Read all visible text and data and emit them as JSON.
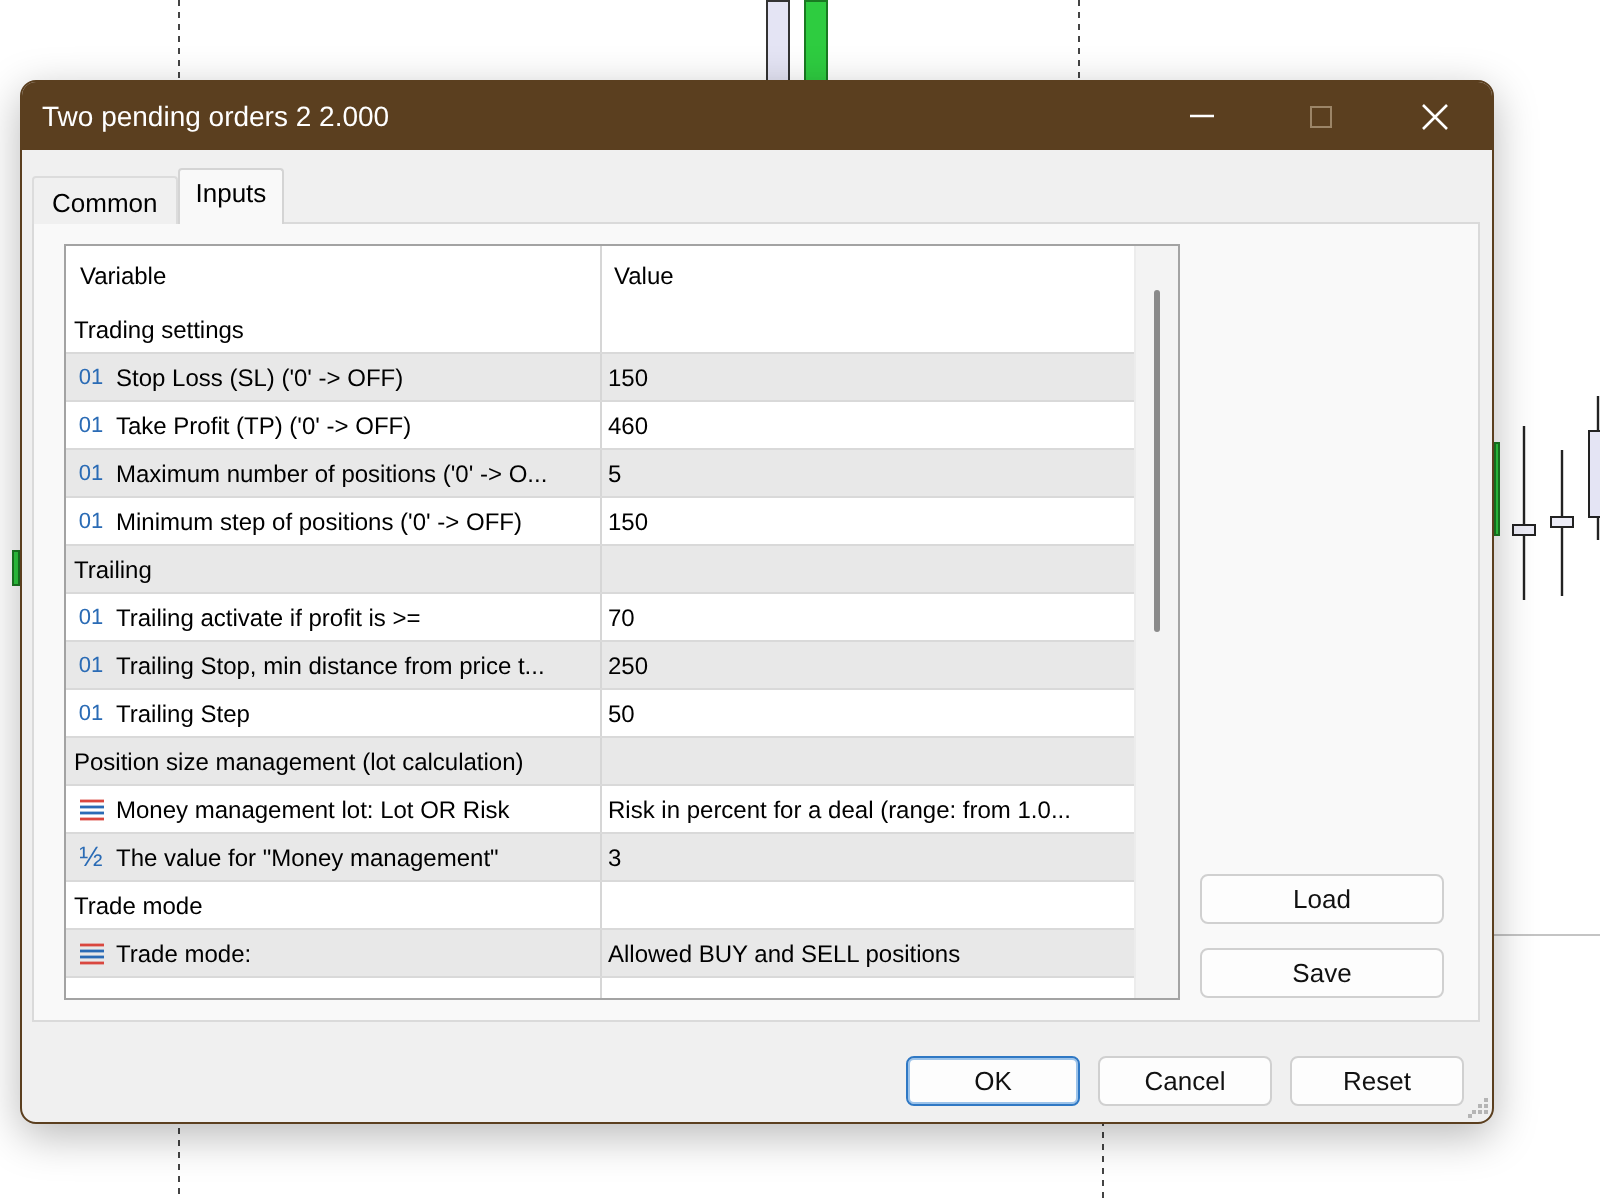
{
  "window": {
    "title": "Two pending orders 2 2.000",
    "maximize_disabled": true
  },
  "tabs": [
    {
      "label": "Common",
      "selected": false
    },
    {
      "label": "Inputs",
      "selected": true
    }
  ],
  "inputs_table": {
    "columns": [
      "Variable",
      "Value"
    ],
    "rows": [
      {
        "kind": "group",
        "variable": "Trading settings"
      },
      {
        "kind": "int",
        "icon": "01",
        "variable": "Stop Loss (SL) ('0' -> OFF)",
        "value": "150"
      },
      {
        "kind": "int",
        "icon": "01",
        "variable": "Take Profit (TP) ('0' -> OFF)",
        "value": "460"
      },
      {
        "kind": "int",
        "icon": "01",
        "variable": "Maximum number of positions ('0' -> O...",
        "value": "5"
      },
      {
        "kind": "int",
        "icon": "01",
        "variable": "Minimum step of positions ('0' -> OFF)",
        "value": "150"
      },
      {
        "kind": "group",
        "variable": "Trailing"
      },
      {
        "kind": "int",
        "icon": "01",
        "variable": "Trailing activate if profit is >=",
        "value": "70"
      },
      {
        "kind": "int",
        "icon": "01",
        "variable": "Trailing Stop, min distance from price t...",
        "value": "250"
      },
      {
        "kind": "int",
        "icon": "01",
        "variable": "Trailing Step",
        "value": "50"
      },
      {
        "kind": "group",
        "variable": "Position size management (lot calculation)"
      },
      {
        "kind": "enum",
        "variable": "Money management lot: Lot OR Risk",
        "value": "Risk in percent for a deal (range: from 1.0..."
      },
      {
        "kind": "double",
        "icon": "½",
        "variable": "The value for \"Money management\"",
        "value": "3"
      },
      {
        "kind": "group",
        "variable": "Trade mode"
      },
      {
        "kind": "enum",
        "variable": "Trade mode:",
        "value": "Allowed BUY and SELL positions"
      }
    ]
  },
  "side_buttons": [
    "Load",
    "Save"
  ],
  "footer_buttons": [
    {
      "label": "OK",
      "default": true
    },
    {
      "label": "Cancel",
      "default": false
    },
    {
      "label": "Reset",
      "default": false
    }
  ]
}
